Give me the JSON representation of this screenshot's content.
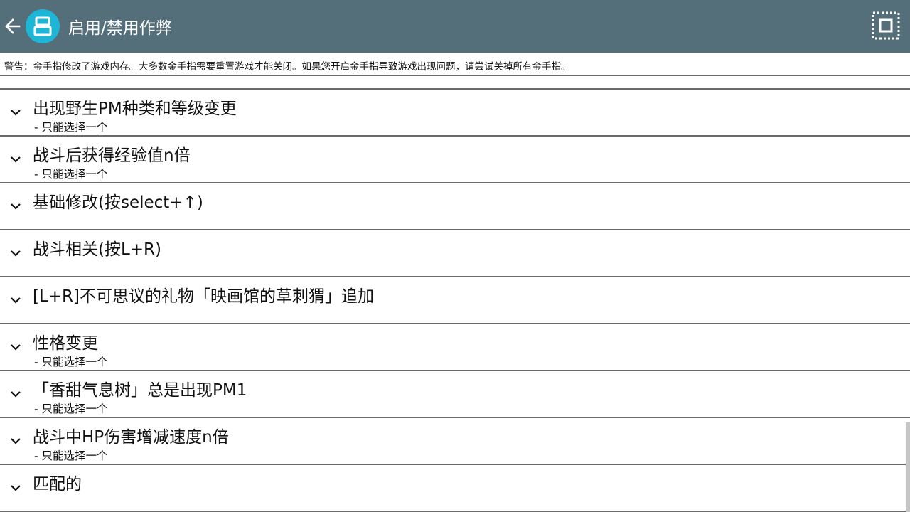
{
  "toolbar": {
    "title": "启用/禁用作弊",
    "icons": {
      "back": "arrow-left-icon",
      "logo": "ds-emulator-logo",
      "grid": "select-all-icon"
    },
    "colors": {
      "toolbar_bg": "#546e7a",
      "logo_bg": "#1eb6d6"
    }
  },
  "warning": {
    "text": "警告：金手指修改了游戏内存。大多数金手指需要重置游戏才能关闭。如果您开启金手指导致游戏出现问题，请尝试关掉所有金手指。"
  },
  "cheat_groups": [
    {
      "title": "出现野生PM种类和等级变更",
      "subtitle": "- 只能选择一个"
    },
    {
      "title": "战斗后获得经验值n倍",
      "subtitle": "- 只能选择一个"
    },
    {
      "title": "基础修改(按select+↑)",
      "subtitle": ""
    },
    {
      "title": "战斗相关(按L+R)",
      "subtitle": ""
    },
    {
      "title": "[L+R]不可思议的礼物「映画馆的草刺猬」追加",
      "subtitle": ""
    },
    {
      "title": "性格变更",
      "subtitle": "- 只能选择一个"
    },
    {
      "title": "「香甜气息树」总是出现PM1",
      "subtitle": "- 只能选择一个"
    },
    {
      "title": "战斗中HP伤害增减速度n倍",
      "subtitle": "- 只能选择一个"
    },
    {
      "title": "匹配的",
      "subtitle": ""
    }
  ],
  "item_icon": "chevron-down-icon"
}
